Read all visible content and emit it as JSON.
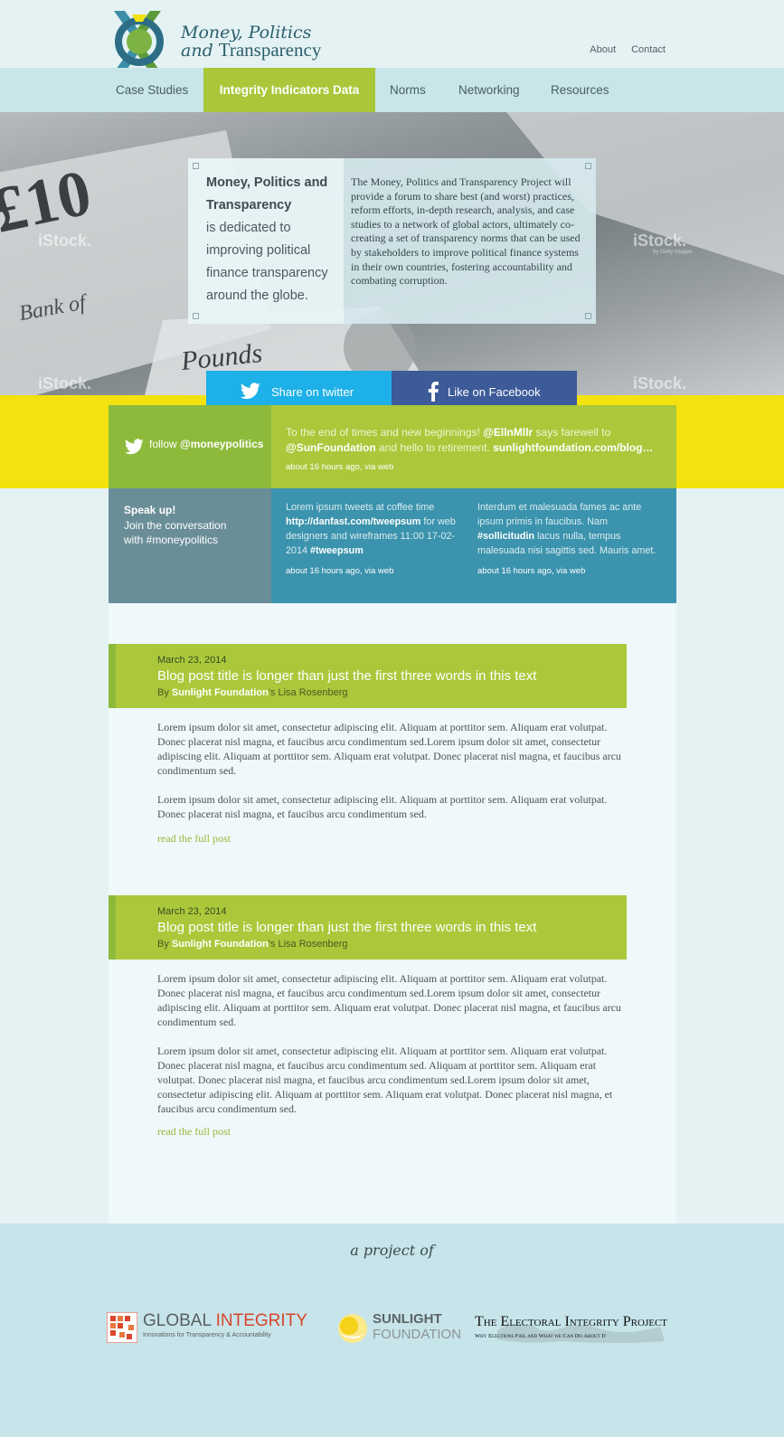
{
  "header": {
    "logo_line1": "Money, Politics",
    "logo_line2_and": "and",
    "logo_line2_word": "Transparency",
    "util_links": [
      "About",
      "Contact"
    ]
  },
  "nav": {
    "items": [
      "Case Studies",
      "Integrity Indicators Data",
      "Norms",
      "Networking",
      "Resources"
    ],
    "active": "Integrity Indicators Data"
  },
  "hero": {
    "heading": "Money, Politics and Transparency",
    "tagline": "is dedicated to improving political finance transparency around the globe.",
    "description": "The Money, Politics and Transparency Project will provide a forum to share best (and worst) practices, reform efforts, in-depth research, analysis, and case studies to a network of global actors, ultimately co-creating a set of transparency norms that can be used by stakeholders to improve political finance systems in their own countries, fostering accountability and combating corruption.",
    "watermark": "iStock.",
    "watermark_credit": "by Getty Images"
  },
  "share": {
    "twitter_label": "Share on twitter",
    "facebook_label": "Like on Facebook"
  },
  "twitter_feature": {
    "follow_prefix": "follow",
    "handle": "@moneypolitics",
    "tweet_part1": "To the end of times and new beginnings!",
    "tweet_mention1": "@EllnMllr",
    "tweet_part2": "says farewell to",
    "tweet_mention2": "@SunFoundation",
    "tweet_part3": "and hello to retirement.",
    "tweet_link": "sunlightfoundation.com/blog…",
    "meta": "about 16 hours ago, via web"
  },
  "conversation": {
    "speak_title": "Speak up!",
    "speak_line1": "Join the conversation",
    "speak_line2": "with #moneypolitics",
    "tweet1_a": "Lorem ipsum tweets at coffee time",
    "tweet1_link": "http://danfast.com/tweepsum",
    "tweet1_b": "for web designers and wireframes 11:00 17-02-2014",
    "tweet1_tag": "#tweepsum",
    "tweet1_meta": "about 16 hours ago, via web",
    "tweet2_a": "Interdum et malesuada fames ac ante ipsum primis in faucibus. Nam",
    "tweet2_tag": "#sollicitudin",
    "tweet2_b": "lacus nulla, tempus malesuada nisi sagittis sed. Mauris amet.",
    "tweet2_meta": "about 16 hours ago, via web"
  },
  "posts": [
    {
      "date": "March 23, 2014",
      "title": "Blog post title is longer than just the first three words in this text",
      "by": "By",
      "org": "Sunlight Foundation",
      "author": "'s Lisa Rosenberg",
      "paragraphs": [
        "Lorem ipsum dolor sit amet, consectetur adipiscing elit. Aliquam at porttitor sem. Aliquam erat volutpat. Donec placerat nisl magna, et faucibus arcu condimentum sed.Lorem ipsum dolor sit amet, consectetur adipiscing elit. Aliquam at porttitor sem. Aliquam erat volutpat. Donec placerat nisl magna, et faucibus arcu condimentum sed.",
        "Lorem ipsum dolor sit amet, consectetur adipiscing elit. Aliquam at porttitor sem. Aliquam erat volutpat. Donec placerat nisl magna, et faucibus arcu condimentum sed."
      ],
      "read_more": "read the full post"
    },
    {
      "date": "March 23, 2014",
      "title": "Blog post title is longer than just the first three words in this text",
      "by": "By",
      "org": "Sunlight Foundation",
      "author": "'s Lisa Rosenberg",
      "paragraphs": [
        "Lorem ipsum dolor sit amet, consectetur adipiscing elit. Aliquam at porttitor sem. Aliquam erat volutpat. Donec placerat nisl magna, et faucibus arcu condimentum sed.Lorem ipsum dolor sit amet, consectetur adipiscing elit. Aliquam at porttitor sem. Aliquam erat volutpat. Donec placerat nisl magna, et faucibus arcu condimentum sed.",
        "Lorem ipsum dolor sit amet, consectetur adipiscing elit. Aliquam at porttitor sem. Aliquam erat volutpat. Donec placerat nisl magna, et faucibus arcu condimentum sed. Aliquam at porttitor sem. Aliquam erat volutpat. Donec placerat nisl magna, et faucibus arcu condimentum sed.Lorem ipsum dolor sit amet, consectetur adipiscing elit. Aliquam at porttitor sem. Aliquam erat volutpat. Donec placerat nisl magna, et faucibus arcu condimentum sed."
      ],
      "read_more": "read the full post"
    }
  ],
  "footer": {
    "project_of": "a project of",
    "global_integrity_1": "GLOBAL",
    "global_integrity_2": "INTEGRITY",
    "global_integrity_tagline": "Innovations for Transparency & Accountability",
    "sunlight_1": "SUNLIGHT",
    "sunlight_2": "FOUNDATION",
    "eip_title": "The Electoral Integrity Project",
    "eip_tagline": "Why Elections Fail and What we Can Do About It"
  },
  "colors": {
    "nav_bg": "#c8e5ea",
    "active_green": "#aac73a",
    "yellow": "#f4e20f",
    "twitter_blue": "#1eb0e8",
    "facebook_blue": "#3d5b98",
    "tweet_teal": "#3b93ad",
    "footer_bg": "#c6e4e9"
  }
}
